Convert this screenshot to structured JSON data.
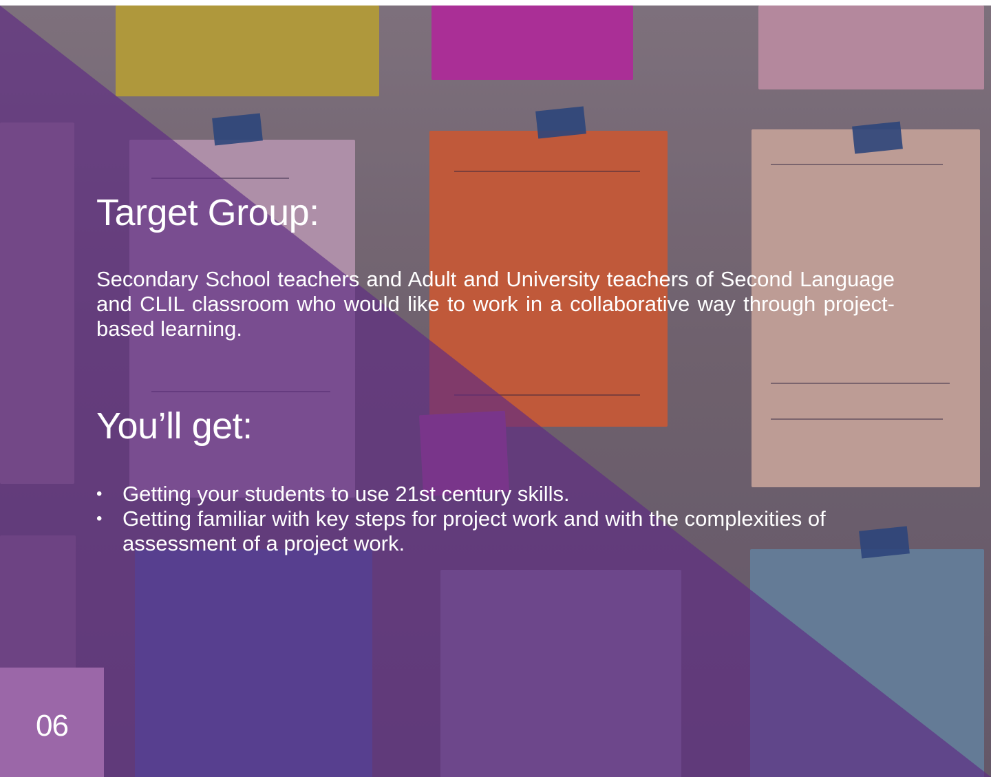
{
  "slide": {
    "target_title": "Target Group:",
    "target_description": "Secondary School teachers and Adult and University teachers of Second Language and CLIL classroom who would like to work in a collaborative way through project-based learning.",
    "get_title": "You’ll get:",
    "bullets": [
      "Getting your students to use 21st century skills.",
      "Getting familiar with key steps for project work and with the complexities of assessment of a project work."
    ],
    "page_number": "06"
  },
  "colors": {
    "overlay_purple": "#5b2a7e",
    "page_box": "#9b67a8",
    "text": "#ffffff"
  }
}
